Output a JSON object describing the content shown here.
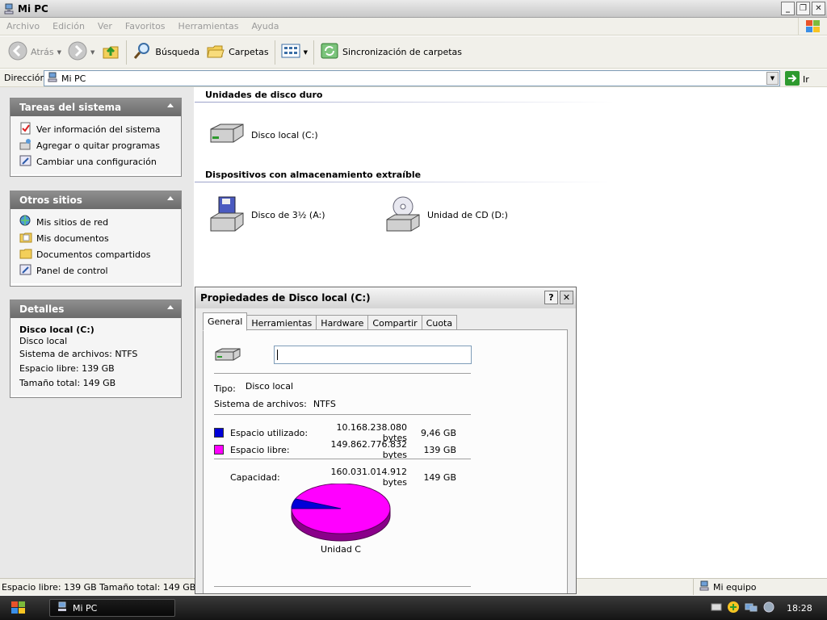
{
  "window": {
    "title": "Mi PC"
  },
  "menubar": {
    "items": [
      "Archivo",
      "Edición",
      "Ver",
      "Favoritos",
      "Herramientas",
      "Ayuda"
    ]
  },
  "toolbar": {
    "back": "Atrás",
    "search": "Búsqueda",
    "folders": "Carpetas",
    "sync": "Sincronización de carpetas"
  },
  "address": {
    "label": "Dirección",
    "value": "Mi PC",
    "go": "Ir"
  },
  "sidebar": {
    "system_tasks": {
      "title": "Tareas del sistema",
      "items": [
        "Ver información del sistema",
        "Agregar o quitar programas",
        "Cambiar una configuración"
      ]
    },
    "other_places": {
      "title": "Otros sitios",
      "items": [
        "Mis sitios de red",
        "Mis documentos",
        "Documentos compartidos",
        "Panel de control"
      ]
    },
    "details": {
      "title": "Detalles",
      "name": "Disco local (C:)",
      "type": "Disco local",
      "fs": "Sistema de archivos: NTFS",
      "free": "Espacio libre: 139 GB",
      "total": "Tamaño total: 149 GB"
    }
  },
  "content": {
    "hard_drives": {
      "title": "Unidades de disco duro",
      "items": [
        "Disco local (C:)"
      ]
    },
    "removable": {
      "title": "Dispositivos con almacenamiento extraíble",
      "items": [
        "Disco de 3½ (A:)",
        "Unidad de CD (D:)"
      ]
    }
  },
  "statusbar": {
    "left": "Espacio libre: 139 GB Tamaño total: 149 GB",
    "right": "Mi equipo"
  },
  "taskbar": {
    "task": "Mi PC",
    "clock": "18:28"
  },
  "dialog": {
    "title": "Propiedades de Disco local (C:)",
    "tabs": [
      "General",
      "Herramientas",
      "Hardware",
      "Compartir",
      "Cuota"
    ],
    "active_tab": "General",
    "name_value": "",
    "type_label": "Tipo:",
    "type_value": "Disco local",
    "fs_label": "Sistema de archivos:",
    "fs_value": "NTFS",
    "used": {
      "label": "Espacio utilizado:",
      "bytes": "10.168.238.080 bytes",
      "gb": "9,46 GB",
      "color": "#0000d8"
    },
    "free": {
      "label": "Espacio libre:",
      "bytes": "149.862.776.832 bytes",
      "gb": "139 GB",
      "color": "#ff00ff"
    },
    "capacity": {
      "label": "Capacidad:",
      "bytes": "160.031.014.912 bytes",
      "gb": "149 GB"
    },
    "pie_label": "Unidad C",
    "used_fraction": 0.0635
  }
}
